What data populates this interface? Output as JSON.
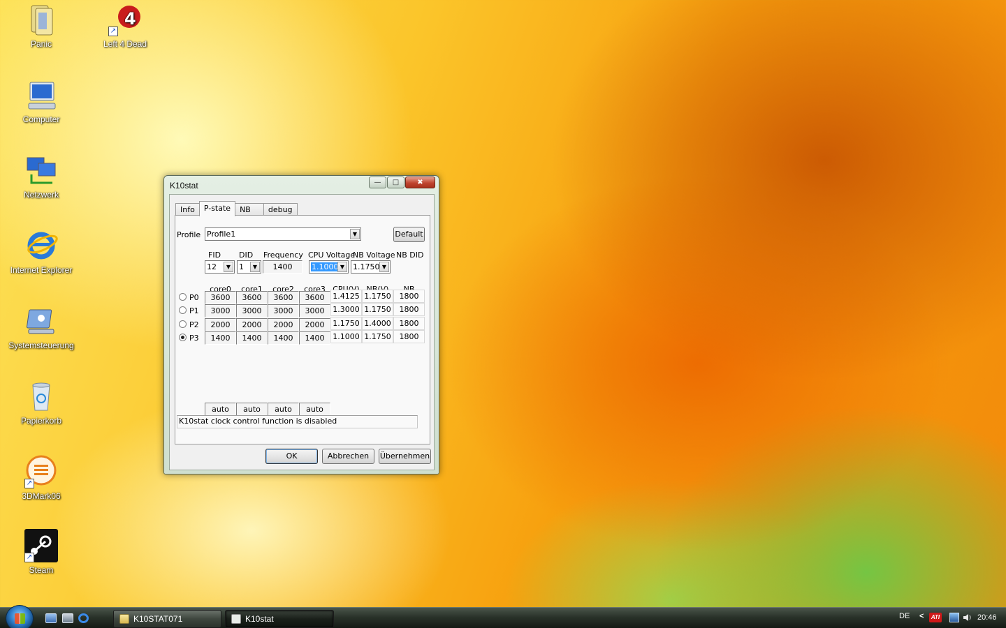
{
  "desktop": {
    "icons": [
      {
        "label": "Panic"
      },
      {
        "label": "Left 4 Dead"
      },
      {
        "label": "Computer"
      },
      {
        "label": "Netzwerk"
      },
      {
        "label": "Internet Explorer"
      },
      {
        "label": "Systemsteuerung"
      },
      {
        "label": "Papierkorb"
      },
      {
        "label": "3DMark06"
      },
      {
        "label": "Steam"
      }
    ]
  },
  "window": {
    "title": "K10stat",
    "controls": {
      "minimize": "—",
      "maximize": "□",
      "close": "✖"
    },
    "tabs": [
      "Info",
      "P-state",
      "NB",
      "debug"
    ],
    "active_tab": "P-state",
    "profile": {
      "label": "Profile",
      "value": "Profile1",
      "default_button": "Default"
    },
    "settings": {
      "headers": [
        "FID",
        "DID",
        "Frequency",
        "CPU Voltage",
        "NB Voltage",
        "NB DID"
      ],
      "fid": "12",
      "did": "1",
      "frequency": "1400",
      "cpu_voltage": "1.1000",
      "nb_voltage": "1.1750"
    },
    "table": {
      "columns": [
        "core0",
        "core1",
        "core2",
        "core3",
        "CPU(V)",
        "NB(V)",
        "NB"
      ],
      "rows": [
        {
          "label": "P0",
          "selected": false,
          "values": [
            "3600",
            "3600",
            "3600",
            "3600",
            "1.4125",
            "1.1750",
            "1800"
          ]
        },
        {
          "label": "P1",
          "selected": false,
          "values": [
            "3000",
            "3000",
            "3000",
            "3000",
            "1.3000",
            "1.1750",
            "1800"
          ]
        },
        {
          "label": "P2",
          "selected": false,
          "values": [
            "2000",
            "2000",
            "2000",
            "2000",
            "1.1750",
            "1.4000",
            "1800"
          ]
        },
        {
          "label": "P3",
          "selected": true,
          "values": [
            "1400",
            "1400",
            "1400",
            "1400",
            "1.1000",
            "1.1750",
            "1800"
          ]
        }
      ],
      "auto_values": [
        "auto",
        "auto",
        "auto",
        "auto"
      ]
    },
    "status": "K10stat clock control function is disabled",
    "buttons": {
      "ok": "OK",
      "cancel": "Abbrechen",
      "apply": "Übernehmen"
    }
  },
  "taskbar": {
    "tasks": [
      "K10STAT071",
      "K10stat"
    ],
    "active_task": "K10stat",
    "language": "DE",
    "tray_chevron": "<",
    "ati_label": "ATI",
    "clock": "20:46"
  }
}
